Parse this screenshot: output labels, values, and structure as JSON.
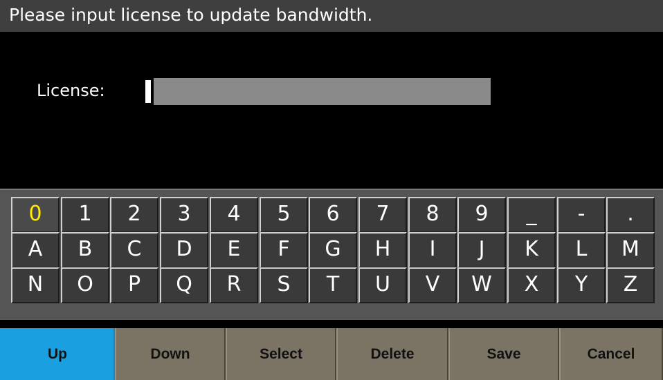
{
  "title": "Please input license to update bandwidth.",
  "license": {
    "label": "License:",
    "value": "",
    "field_color": "#8a8a8a"
  },
  "keyboard": {
    "selected_key": "0",
    "highlight_color": "#ffea00",
    "rows": [
      [
        "0",
        "1",
        "2",
        "3",
        "4",
        "5",
        "6",
        "7",
        "8",
        "9",
        "_",
        "-",
        "."
      ],
      [
        "A",
        "B",
        "C",
        "D",
        "E",
        "F",
        "G",
        "H",
        "I",
        "J",
        "K",
        "L",
        "M"
      ],
      [
        "N",
        "O",
        "P",
        "Q",
        "R",
        "S",
        "T",
        "U",
        "V",
        "W",
        "X",
        "Y",
        "Z"
      ]
    ]
  },
  "softkeys": {
    "up": "Up",
    "down": "Down",
    "select": "Select",
    "delete": "Delete",
    "save": "Save",
    "cancel": "Cancel",
    "active": "Up",
    "active_color": "#1aa0e0",
    "inactive_color": "#7b7363"
  }
}
